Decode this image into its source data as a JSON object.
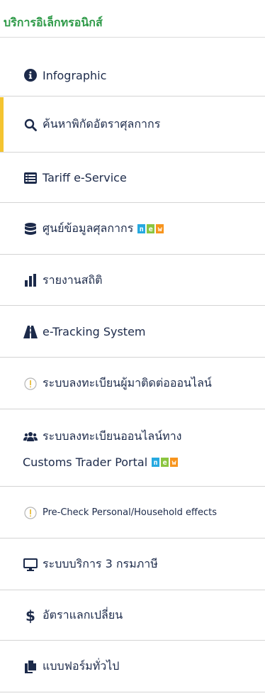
{
  "title": "บริการอิเล็กทรอนิกส์",
  "accent_color": "#f4c430",
  "title_color": "#2e9a48",
  "items": [
    {
      "label": "Infographic",
      "icon": "info-circle-icon"
    },
    {
      "label": "ค้นหาพิกัดอัตราศุลกากร",
      "icon": "search-icon",
      "active": true
    },
    {
      "label": "Tariff e-Service",
      "icon": "list-table-icon"
    },
    {
      "label": "ศูนย์ข้อมูลศุลกากร",
      "icon": "database-icon",
      "badge": "new"
    },
    {
      "label": "รายงานสถิติ",
      "icon": "bar-chart-icon"
    },
    {
      "label": "e-Tracking System",
      "icon": "road-icon"
    },
    {
      "label": "ระบบลงทะเบียนผู้มาติดต่อออนไลน์",
      "icon": "exclamation-circle-icon"
    },
    {
      "label": "ระบบลงทะเบียนออนไลน์ทาง",
      "label2": "Customs Trader Portal",
      "icon": "users-icon",
      "badge": "new"
    },
    {
      "label": "Pre-Check Personal/Household effects",
      "icon": "exclamation-circle-icon"
    },
    {
      "label": "ระบบบริการ 3 กรมภาษี",
      "icon": "monitor-icon"
    },
    {
      "label": "อัตราแลกเปลี่ยน",
      "icon": "dollar-icon"
    },
    {
      "label": "แบบฟอร์มทั่วไป",
      "icon": "documents-icon"
    }
  ],
  "badge_letters": [
    "n",
    "e",
    "w"
  ]
}
